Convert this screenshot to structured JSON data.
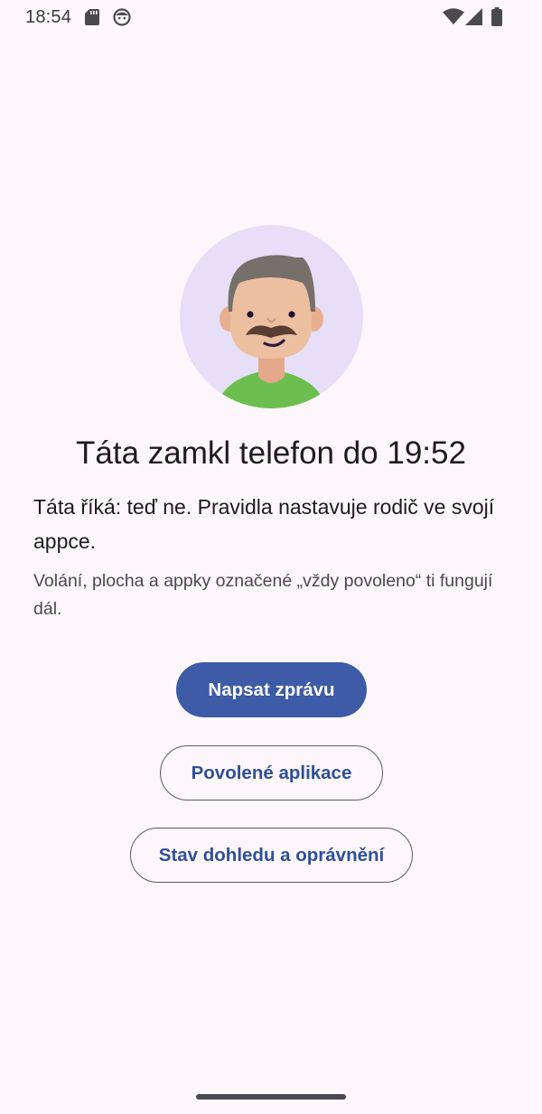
{
  "status_bar": {
    "time": "18:54",
    "icons": [
      "sd-card-icon",
      "face-icon",
      "wifi-icon",
      "signal-icon",
      "battery-icon"
    ]
  },
  "avatar": {
    "icon": "parent-avatar-icon",
    "colors": {
      "background": "#E6DFF7",
      "shirt": "#6CBF4E",
      "skin": "#EDBFA1",
      "hair": "#76706A",
      "mustache": "#5B3E32"
    }
  },
  "lock_screen": {
    "title": "Táta zamkl telefon do 19:52",
    "message": "Táta říká: teď ne. Pravidla nastavuje rodič ve svojí appce.",
    "note": "Volání, plocha a appky označené „vždy povoleno“ ti fungují dál."
  },
  "actions": {
    "send_message": "Napsat zprávu",
    "allowed_apps": "Povolené aplikace",
    "supervision_status": "Stav dohledu a oprávnění"
  },
  "colors": {
    "background": "#FDF7FC",
    "primary": "#3D5BA6",
    "outline_text": "#2F4F97"
  }
}
